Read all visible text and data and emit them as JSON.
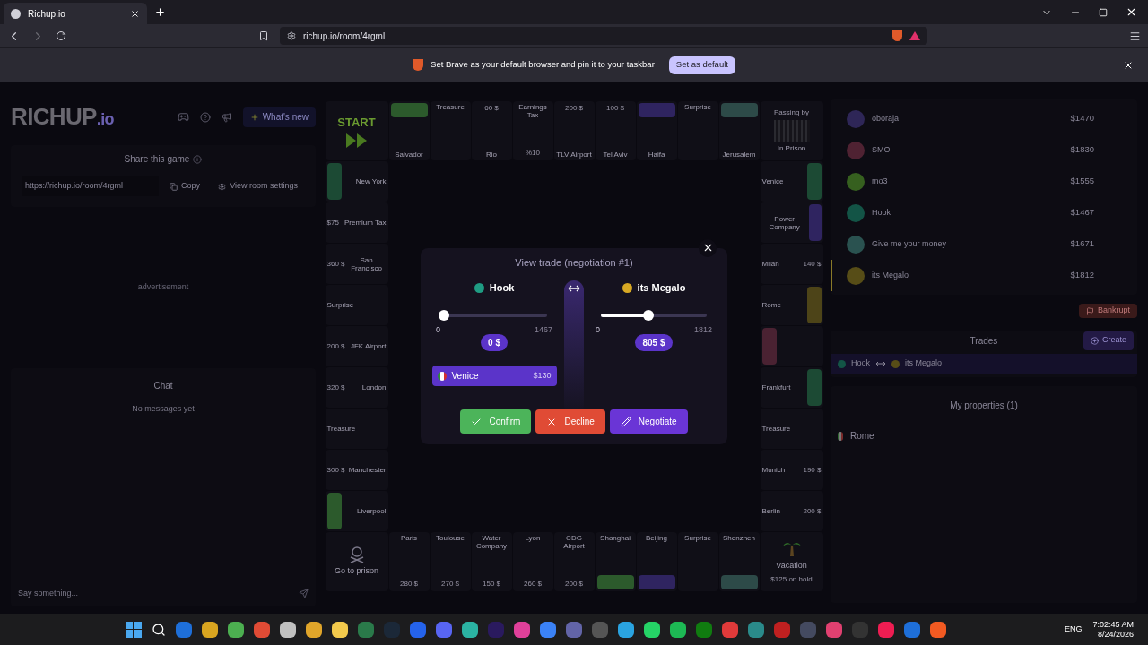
{
  "browser": {
    "tab_title": "Richup.io",
    "url": "richup.io/room/4rgml",
    "banner_text": "Set Brave as your default browser and pin it to your taskbar",
    "banner_button": "Set as default"
  },
  "left_panel": {
    "logo": "RICHUP",
    "logo_suffix": ".io",
    "whats_new": "What's new",
    "share_title": "Share this game",
    "share_url": "https://richup.io/room/4rgml",
    "copy": "Copy",
    "room_settings": "View room settings",
    "ad_label": "advertisement",
    "chat_title": "Chat",
    "chat_empty": "No messages yet",
    "chat_placeholder": "Say something..."
  },
  "board": {
    "corners": [
      {
        "kind": "start",
        "label": "START"
      },
      {
        "kind": "prison",
        "label": "Passing by",
        "sub": "In Prison"
      },
      {
        "kind": "go_to_prison",
        "label": "Go to prison"
      },
      {
        "kind": "vacation",
        "label": "Vacation",
        "sub": "$125 on hold"
      }
    ],
    "top": [
      {
        "name": "Salvador",
        "color": "#2c5a2c"
      },
      {
        "name": "Treasure"
      },
      {
        "name": "Rio",
        "price": "60 $"
      },
      {
        "name": "Earnings Tax",
        "sub": "%10"
      },
      {
        "name": "TLV Airport",
        "price": "200 $"
      },
      {
        "name": "Tel Aviv",
        "price": "100 $"
      },
      {
        "name": "Haifa",
        "color": "#2f2460"
      },
      {
        "name": "Surprise"
      },
      {
        "name": "Jerusalem",
        "color": "#2d4a48"
      }
    ],
    "right": [
      {
        "name": "Venice",
        "color": "#1c4a34"
      },
      {
        "name": "Power Company",
        "color": "#2f2460"
      },
      {
        "name": "Milan",
        "price": "140 $"
      },
      {
        "name": "Rome",
        "color": "#4d4418"
      },
      {
        "color": "#4a2232"
      },
      {
        "name": "Frankfurt",
        "color": "#1c4a34"
      },
      {
        "name": "Treasure"
      },
      {
        "name": "Munich",
        "price": "190 $"
      },
      {
        "name": "Berlin",
        "price": "200 $"
      }
    ],
    "bottom": [
      {
        "name": "Paris",
        "price": "280 $"
      },
      {
        "name": "Toulouse",
        "price": "270 $"
      },
      {
        "name": "Water Company",
        "price": "150 $"
      },
      {
        "name": "Lyon",
        "price": "260 $"
      },
      {
        "name": "CDG Airport",
        "price": "200 $"
      },
      {
        "name": "Shanghai",
        "color": "#2c5a2c"
      },
      {
        "name": "Beijing",
        "color": "#2f2460"
      },
      {
        "name": "Surprise"
      },
      {
        "name": "Shenzhen",
        "color": "#2d4a48"
      }
    ],
    "left": [
      {
        "name": "New York",
        "color": "#1c4a34"
      },
      {
        "name": "Premium Tax",
        "price": "$75"
      },
      {
        "name": "San Francisco",
        "price": "360 $"
      },
      {
        "name": "Surprise"
      },
      {
        "name": "JFK Airport",
        "price": "200 $"
      },
      {
        "name": "London",
        "price": "320 $"
      },
      {
        "name": "Treasure"
      },
      {
        "name": "Manchester",
        "price": "300 $"
      },
      {
        "name": "Liverpool",
        "color": "#2c5a2c"
      }
    ]
  },
  "trade_modal": {
    "title": "View trade (negotiation #1)",
    "sides": [
      {
        "player": "Hook",
        "color": "#1f9c83",
        "min": "0",
        "max": "1467",
        "amount": "0 $",
        "level": 0,
        "properties": [
          {
            "name": "Venice",
            "price": "$130"
          }
        ]
      },
      {
        "player": "its Megalo",
        "color": "#d7a824",
        "min": "0",
        "max": "1812",
        "amount": "805 $",
        "level": 0.444
      }
    ],
    "buttons": [
      {
        "kind": "confirm",
        "label": "Confirm"
      },
      {
        "kind": "decline",
        "label": "Decline"
      },
      {
        "kind": "negotiate",
        "label": "Negotiate"
      }
    ]
  },
  "players": [
    {
      "name": "oboraja",
      "money": "$1470",
      "color": "#2e2657",
      "selected": false
    },
    {
      "name": "SMO",
      "money": "$1830",
      "color": "#4f2232",
      "selected": false
    },
    {
      "name": "mo3",
      "money": "$1555",
      "color": "#36601f",
      "selected": false
    },
    {
      "name": "Hook",
      "money": "$1467",
      "color": "#135446",
      "selected": false
    },
    {
      "name": "Give me your money",
      "money": "$1671",
      "color": "#2a5250",
      "selected": false
    },
    {
      "name": "its Megalo",
      "money": "$1812",
      "color": "#574d17",
      "selected": true
    }
  ],
  "right_panel": {
    "bankrupt": "Bankrupt",
    "trades_title": "Trades",
    "create": "Create",
    "trades": [
      {
        "from": {
          "name": "Hook",
          "color": "#135446"
        },
        "to": {
          "name": "its Megalo",
          "color": "#574d17"
        }
      }
    ],
    "properties_title": "My properties (1)",
    "properties": [
      {
        "name": "Rome"
      }
    ]
  },
  "taskbar": {
    "language": "ENG",
    "time": "7:02:45 AM",
    "date": "8/24/2026"
  }
}
